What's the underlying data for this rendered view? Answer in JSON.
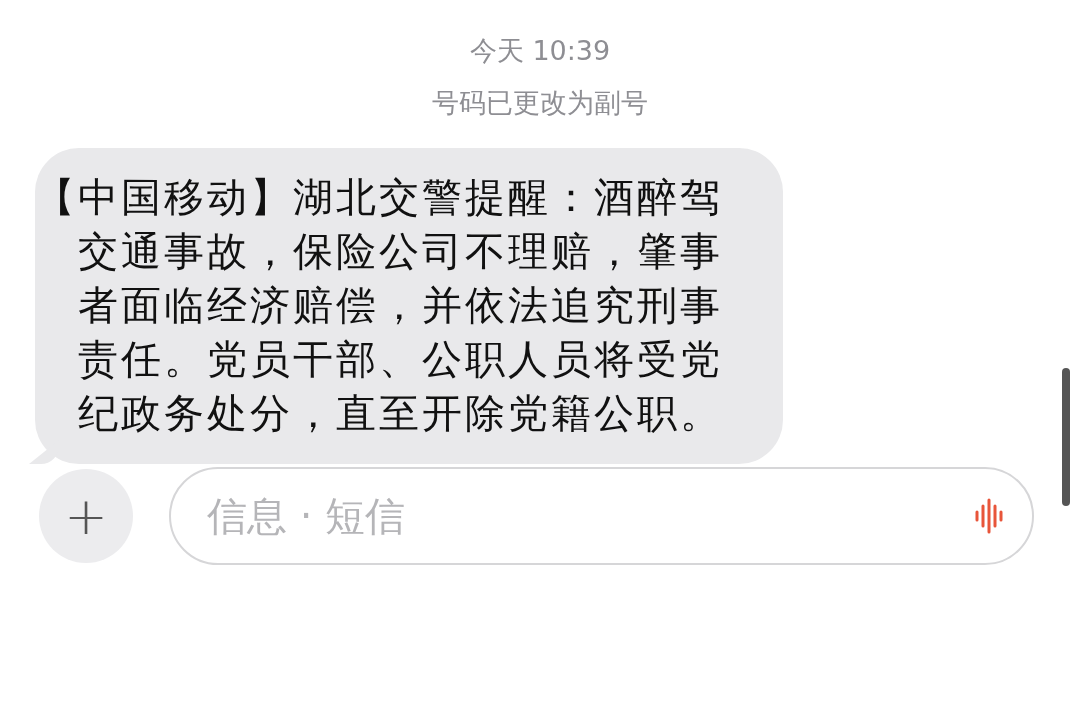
{
  "timestamp": "今天 10:39",
  "notice": "号码已更改为副号",
  "messages": [
    {
      "kind": "incoming",
      "text": "【中国移动】湖北交警提醒：酒醉驾交通事故，保险公司不理赔，肇事者面临经济赔偿，并依法追究刑事责任。党员干部、公职人员将受党纪政务处分，直至开除党籍公职。"
    }
  ],
  "composer": {
    "add_button": "+",
    "field": {
      "placeholder": "信息 · 短信"
    }
  }
}
